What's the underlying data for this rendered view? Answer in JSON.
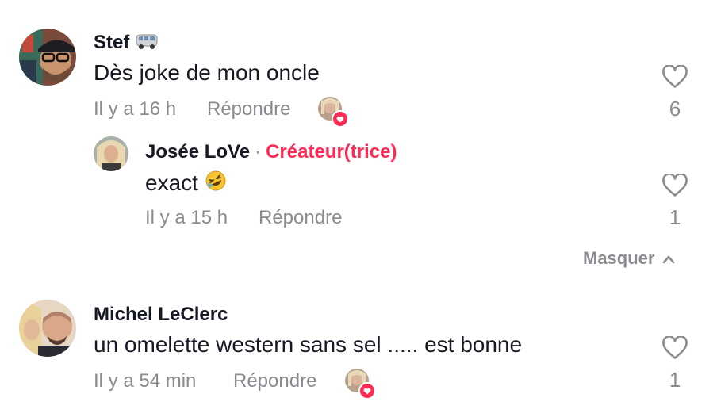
{
  "comments": [
    {
      "username": "Stef",
      "username_badge_icon": "van-emoji-icon",
      "text": "Dès joke de mon oncle",
      "time": "Il y a 16 h",
      "reply_label": "Répondre",
      "like_count": "6",
      "creator_liked": true,
      "replies": [
        {
          "username": "Josée LoVe",
          "separator": "·",
          "creator_label": "Créateur(trice)",
          "text": "exact",
          "text_emoji_icon": "rolling-laughing-emoji-icon",
          "time": "Il y a 15 h",
          "reply_label": "Répondre",
          "like_count": "1"
        }
      ],
      "hide_label": "Masquer"
    },
    {
      "username": "Michel LeClerc",
      "text": "un omelette western sans sel ..... est bonne",
      "time": "Il y a 54 min",
      "reply_label": "Répondre",
      "like_count": "1",
      "creator_liked": true
    }
  ],
  "colors": {
    "accent": "#fe2c55",
    "muted": "#8a8b91",
    "text": "#161823"
  }
}
